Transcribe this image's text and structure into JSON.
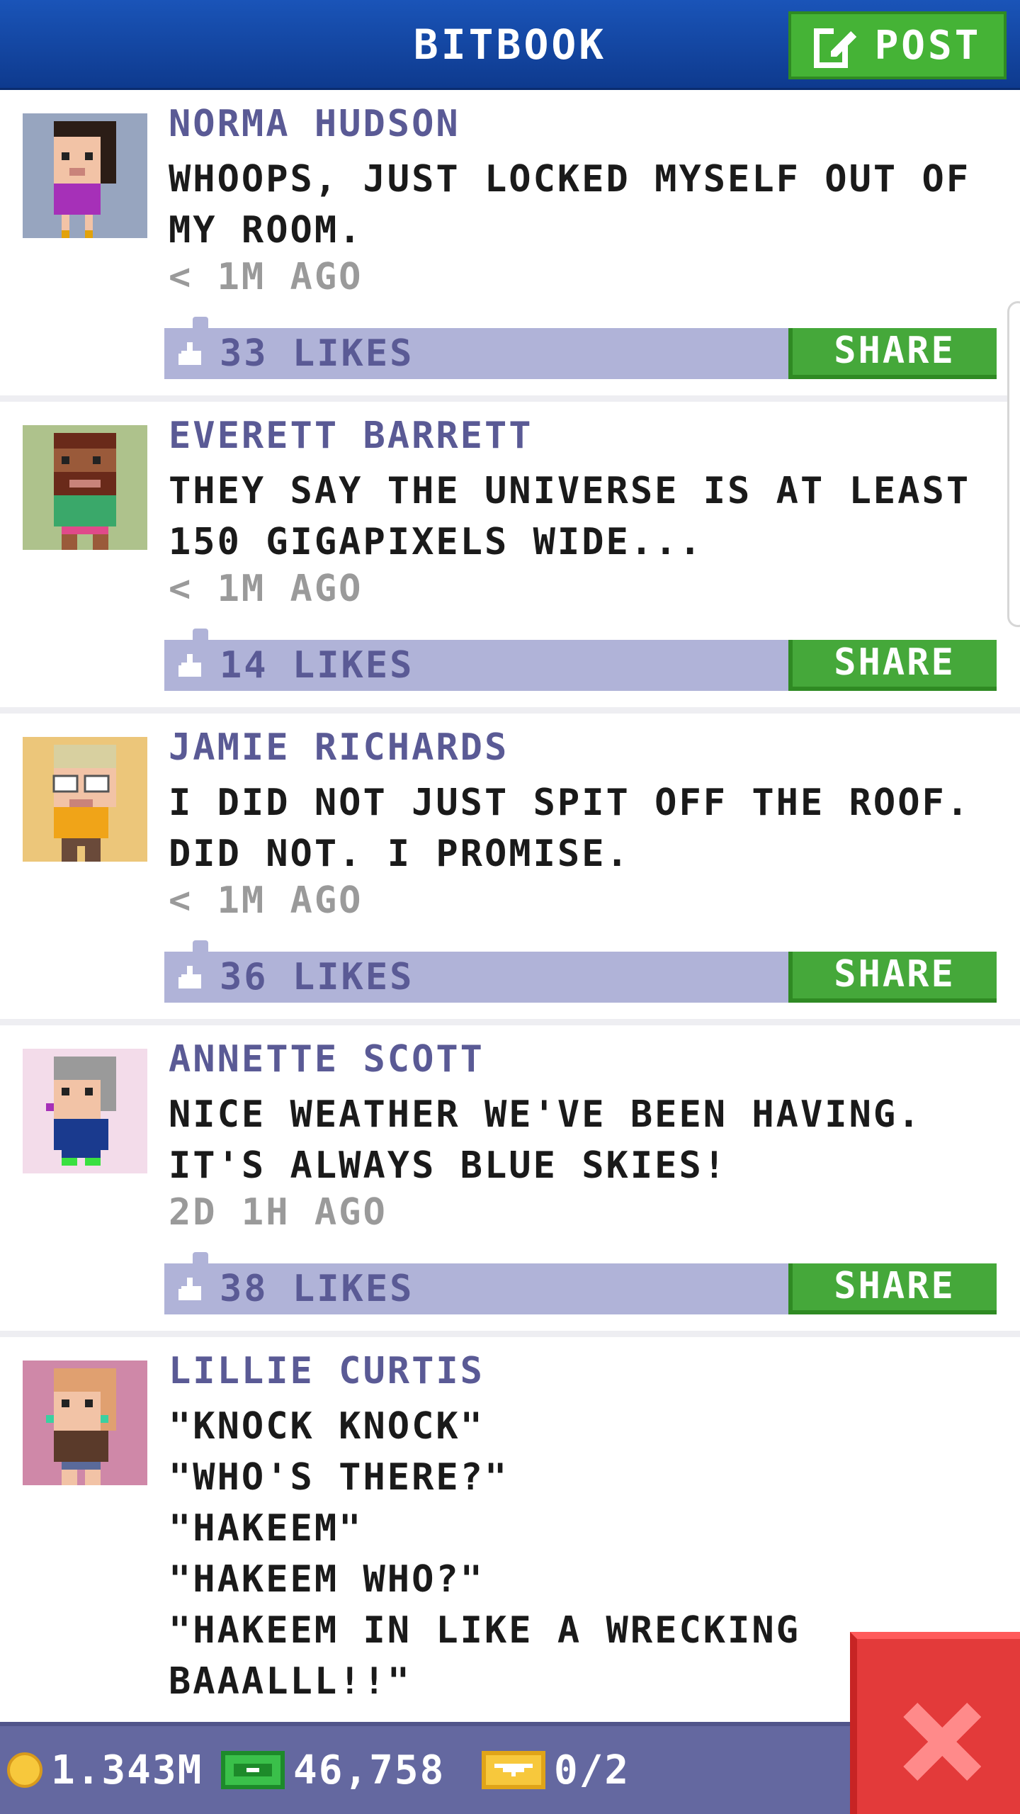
{
  "header": {
    "title": "BITBOOK",
    "post_label": "POST"
  },
  "posts": [
    {
      "author": "NORMA HUDSON",
      "message": "WHOOPS, JUST LOCKED MYSELF OUT OF MY ROOM.",
      "time": "< 1M AGO",
      "likes": "33 LIKES",
      "share_label": "SHARE",
      "avatar_bg": "#97a5bf"
    },
    {
      "author": "EVERETT BARRETT",
      "message": "THEY SAY THE UNIVERSE IS AT LEAST 150 GIGAPIXELS WIDE...",
      "time": "< 1M AGO",
      "likes": "14 LIKES",
      "share_label": "SHARE",
      "avatar_bg": "#aec28c"
    },
    {
      "author": "JAMIE RICHARDS",
      "message": "I DID NOT JUST SPIT OFF THE ROOF. DID NOT. I PROMISE.",
      "time": "< 1M AGO",
      "likes": "36 LIKES",
      "share_label": "SHARE",
      "avatar_bg": "#ecc67a"
    },
    {
      "author": "ANNETTE SCOTT",
      "message": "NICE WEATHER WE'VE BEEN HAVING. IT'S ALWAYS BLUE SKIES!",
      "time": "2D 1H AGO",
      "likes": "38 LIKES",
      "share_label": "SHARE",
      "avatar_bg": "#f3dcea"
    },
    {
      "author": "LILLIE CURTIS",
      "message": "\"KNOCK KNOCK\"\n\"WHO'S THERE?\"\n\"HAKEEM\"\n\"HAKEEM WHO?\"\n\"HAKEEM IN LIKE A WRECKING BAAALLL!!\"",
      "avatar_bg": "#cf88a8"
    }
  ],
  "status": {
    "coins": "1.343M",
    "bux": "46,758",
    "tickets": "0/2"
  },
  "icons": {
    "compose": "compose-icon",
    "thumb": "thumbs-up-icon",
    "coin": "coin-icon",
    "bux": "bux-icon",
    "ticket": "ticket-icon",
    "close": "close-icon"
  },
  "colors": {
    "header": "#1a54b8",
    "accent_green": "#45b336",
    "likes_bar": "#b0b3d8",
    "author_text": "#5a5a95",
    "status_bar": "#6468a0",
    "close_red": "#e33a3a"
  }
}
